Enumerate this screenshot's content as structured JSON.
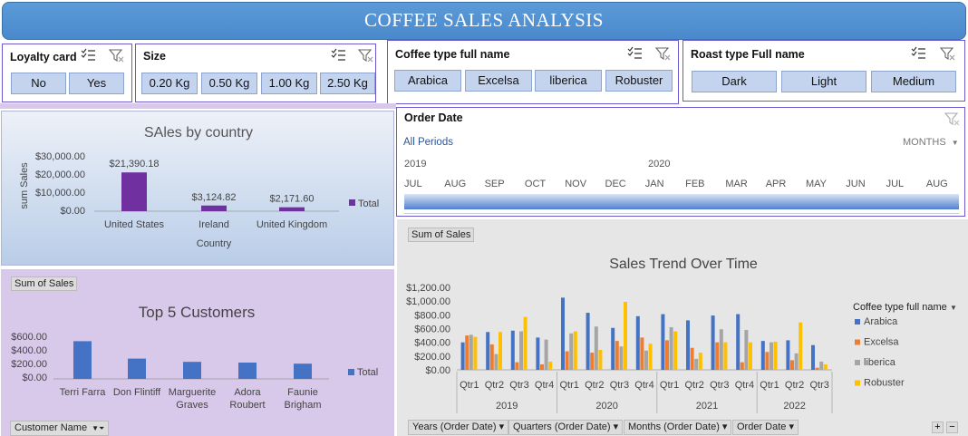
{
  "title": "COFFEE SALES ANALYSIS",
  "colors": {
    "banner": "#4a89cc",
    "slicer_button": "#c5d4ee",
    "purple_bar": "#7030a0",
    "blue_bar": "#4472c4",
    "arabica": "#4472c4",
    "excelsa": "#ed7d31",
    "liberica": "#a5a5a5",
    "robuster": "#ffc000"
  },
  "slicers": {
    "loyalty": {
      "title": "Loyalty card",
      "items": [
        "No",
        "Yes"
      ]
    },
    "size": {
      "title": "Size",
      "items": [
        "0.20 Kg",
        "0.50 Kg",
        "1.00 Kg",
        "2.50 Kg"
      ]
    },
    "coffee": {
      "title": "Coffee type full name",
      "items": [
        "Arabica",
        "Excelsa",
        "liberica",
        "Robuster"
      ]
    },
    "roast": {
      "title": "Roast type Full name",
      "items": [
        "Dark",
        "Light",
        "Medium"
      ]
    }
  },
  "order_date": {
    "title": "Order Date",
    "period": "All Periods",
    "level": "MONTHS",
    "years": [
      "2019",
      "2020"
    ],
    "months": [
      "JUL",
      "AUG",
      "SEP",
      "OCT",
      "NOV",
      "DEC",
      "JAN",
      "FEB",
      "MAR",
      "APR",
      "MAY",
      "JUN",
      "JUL",
      "AUG"
    ]
  },
  "country_chart": {
    "title": "SAles by country",
    "ylabel": "sum Sales",
    "xlabel": "Country",
    "legend": "Total",
    "ticks": [
      "$30,000.00",
      "$20,000.00",
      "$10,000.00",
      "$0.00"
    ]
  },
  "customer_chart": {
    "tag": "Sum of Sales",
    "title": "Top 5 Customers",
    "legend": "Total",
    "ticks": [
      "$600.00",
      "$400.00",
      "$200.00",
      "$0.00"
    ],
    "field_button": "Customer Name"
  },
  "trend_chart": {
    "tag": "Sum of Sales",
    "title": "Sales Trend Over Time",
    "legend_title": "Coffee type full name",
    "ticks": [
      "$1,200.00",
      "$1,000.00",
      "$800.00",
      "$600.00",
      "$400.00",
      "$200.00",
      "$0.00"
    ],
    "field_buttons": [
      "Years (Order Date)",
      "Quarters (Order Date)",
      "Months (Order Date)",
      "Order Date"
    ]
  },
  "chart_data": [
    {
      "type": "bar",
      "title": "SAles by country",
      "xlabel": "Country",
      "ylabel": "sum Sales",
      "categories": [
        "United States",
        "Ireland",
        "United Kingdom"
      ],
      "series": [
        {
          "name": "Total",
          "values": [
            21390.18,
            3124.82,
            2171.6
          ]
        }
      ],
      "data_labels": [
        "$21,390.18",
        "$3,124.82",
        "$2,171.60"
      ],
      "ylim": [
        0,
        30000
      ],
      "legend": "right"
    },
    {
      "type": "bar",
      "title": "Top 5 Customers",
      "categories": [
        "Terri Farra",
        "Don Flintiff",
        "Marguerite Graves",
        "Adora Roubert",
        "Faunie Brigham"
      ],
      "series": [
        {
          "name": "Total",
          "values": [
            520,
            280,
            235,
            225,
            210
          ]
        }
      ],
      "ylim": [
        0,
        600
      ],
      "legend": "right"
    },
    {
      "type": "bar",
      "title": "Sales Trend Over Time",
      "years": [
        "2019",
        "2020",
        "2021",
        "2022"
      ],
      "categories": [
        "Qtr1",
        "Qtr2",
        "Qtr3",
        "Qtr4",
        "Qtr1",
        "Qtr2",
        "Qtr3",
        "Qtr4",
        "Qtr1",
        "Qtr2",
        "Qtr3",
        "Qtr4",
        "Qtr1",
        "Qtr2",
        "Qtr3"
      ],
      "series": [
        {
          "name": "Arabica",
          "values": [
            400,
            550,
            570,
            470,
            1050,
            830,
            610,
            780,
            810,
            720,
            790,
            810,
            420,
            430,
            360
          ]
        },
        {
          "name": "Excelsa",
          "values": [
            500,
            370,
            110,
            80,
            270,
            250,
            420,
            470,
            430,
            320,
            400,
            110,
            260,
            140,
            30
          ]
        },
        {
          "name": "liberica",
          "values": [
            510,
            230,
            560,
            440,
            530,
            630,
            340,
            280,
            620,
            160,
            590,
            580,
            400,
            240,
            120
          ]
        },
        {
          "name": "Robuster",
          "values": [
            480,
            550,
            770,
            120,
            560,
            290,
            990,
            380,
            560,
            250,
            400,
            400,
            410,
            690,
            80
          ]
        }
      ],
      "ylim": [
        0,
        1200
      ],
      "legend": "right"
    }
  ]
}
